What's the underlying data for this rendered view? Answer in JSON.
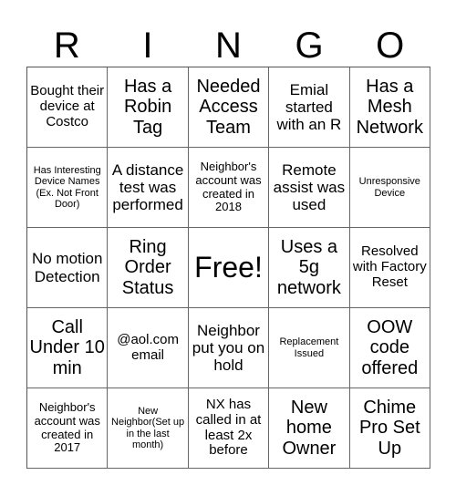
{
  "header": {
    "letters": [
      "R",
      "I",
      "N",
      "G",
      "O"
    ]
  },
  "board": {
    "cells": [
      [
        "Bought their device at Costco",
        "Has a Robin Tag",
        "Needed Access Team",
        "Emial started with an R",
        "Has a Mesh Network"
      ],
      [
        "Has Interesting Device Names (Ex. Not Front Door)",
        "A distance test was performed",
        "Neighbor's account was created in 2018",
        "Remote assist was used",
        "Unresponsive Device"
      ],
      [
        "No motion Detection",
        "Ring Order Status",
        "Free!",
        "Uses a 5g network",
        "Resolved with Factory Reset"
      ],
      [
        "Call Under 10 min",
        "@aol.com email",
        "Neighbor put you on hold",
        "Replacement Issued",
        "OOW code offered"
      ],
      [
        "Neighbor's account was created in 2017",
        "New Neighbor(Set up in the last month)",
        "NX has called in at least 2x before",
        "New home Owner",
        "Chime Pro Set Up"
      ]
    ]
  }
}
